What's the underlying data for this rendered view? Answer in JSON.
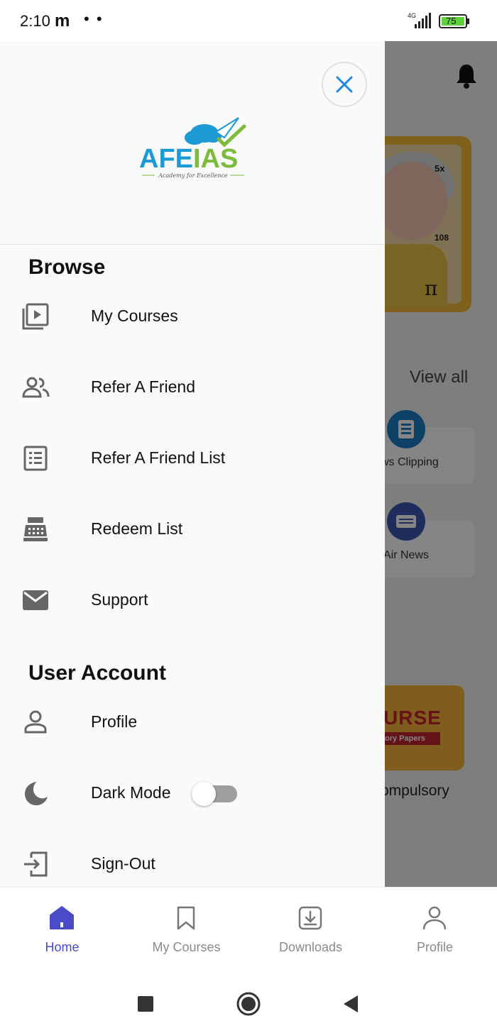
{
  "status_bar": {
    "time": "2:10",
    "carrier_glyph": "m",
    "dots": "• •",
    "network": "4G",
    "battery": "75"
  },
  "background": {
    "view_all": "View all",
    "cards": [
      {
        "label": "ws Clipping",
        "icon": "newspaper-icon",
        "color": "#1a7fc4"
      },
      {
        "label": "Air News",
        "icon": "radio-icon",
        "color": "#3a56b0"
      }
    ],
    "course_banner_word": "URSE",
    "course_banner_sub": "ory Papers",
    "course_title": "ompulsory",
    "banner_text_1": "5x",
    "banner_text_2": "108",
    "banner_pi": "π"
  },
  "drawer": {
    "logo_text": "AFEIAS",
    "logo_tagline": "Academy for Excellence",
    "browse_title": "Browse",
    "browse_items": [
      {
        "label": "My Courses",
        "icon": "play-library-icon"
      },
      {
        "label": "Refer A Friend",
        "icon": "people-icon"
      },
      {
        "label": "Refer A Friend List",
        "icon": "list-icon"
      },
      {
        "label": "Redeem List",
        "icon": "cash-register-icon"
      },
      {
        "label": "Support",
        "icon": "mail-icon"
      }
    ],
    "account_title": "User Account",
    "account_items": [
      {
        "label": "Profile",
        "icon": "person-icon"
      },
      {
        "label": "Dark Mode",
        "icon": "moon-icon",
        "toggle": false
      },
      {
        "label": "Sign-Out",
        "icon": "sign-out-icon"
      }
    ]
  },
  "bottom_nav": {
    "items": [
      {
        "label": "Home",
        "icon": "home-icon",
        "active": true
      },
      {
        "label": "My Courses",
        "icon": "bookmark-icon",
        "active": false
      },
      {
        "label": "Downloads",
        "icon": "download-icon",
        "active": false
      },
      {
        "label": "Profile",
        "icon": "person-icon",
        "active": false
      }
    ]
  },
  "colors": {
    "accent": "#4b4bc7",
    "close_icon": "#1e88e5",
    "logo_blue": "#1b9ad6",
    "logo_green": "#7dbb3c"
  }
}
